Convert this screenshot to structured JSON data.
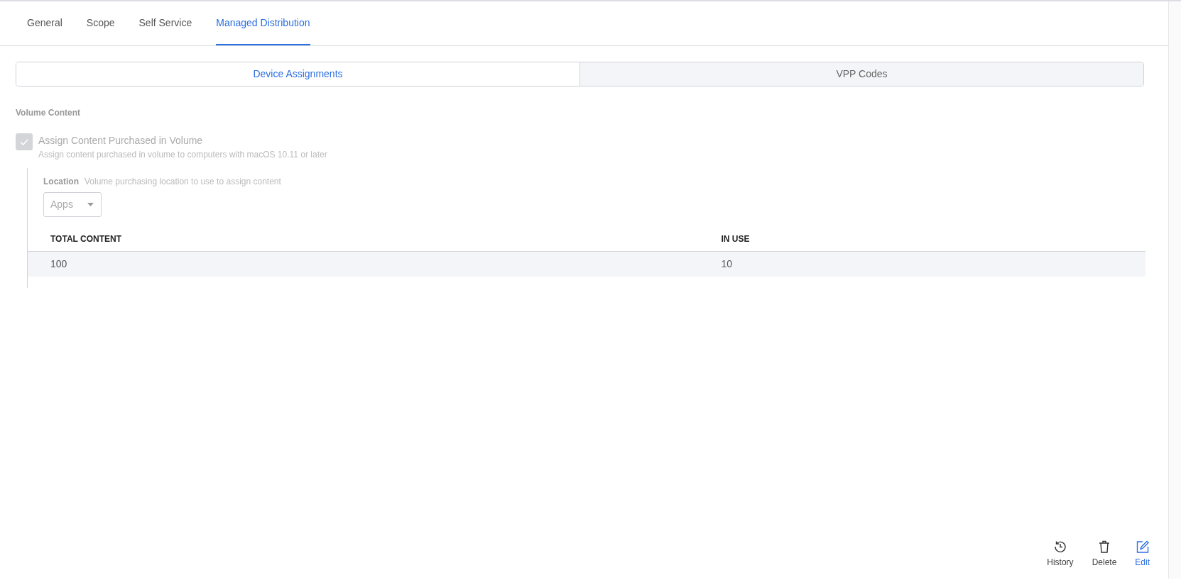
{
  "tabs": [
    {
      "label": "General",
      "selected": false
    },
    {
      "label": "Scope",
      "selected": false
    },
    {
      "label": "Self Service",
      "selected": false
    },
    {
      "label": "Managed Distribution",
      "selected": true
    }
  ],
  "segments": [
    {
      "label": "Device Assignments",
      "selected": true
    },
    {
      "label": "VPP Codes",
      "selected": false
    }
  ],
  "section_title": "Volume Content",
  "assign_option": {
    "label": "Assign Content Purchased in Volume",
    "description": "Assign content purchased in volume to computers with macOS 10.11 or later",
    "checked": true,
    "disabled": true
  },
  "location": {
    "label": "Location",
    "hint": "Volume purchasing location to use to assign content",
    "value": "Apps",
    "disabled": true
  },
  "table": {
    "columns": [
      "TOTAL CONTENT",
      "IN USE"
    ],
    "rows": [
      [
        "100",
        "10"
      ]
    ]
  },
  "actions": [
    {
      "kind": "history",
      "label": "History"
    },
    {
      "kind": "delete",
      "label": "Delete"
    },
    {
      "kind": "edit",
      "label": "Edit"
    }
  ]
}
